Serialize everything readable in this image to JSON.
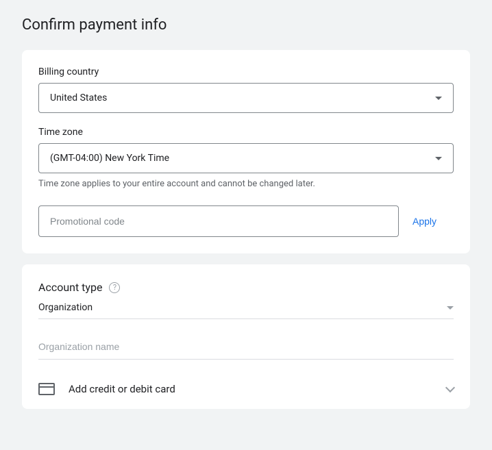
{
  "page_title": "Confirm payment info",
  "billing": {
    "country_label": "Billing country",
    "country_value": "United States",
    "timezone_label": "Time zone",
    "timezone_value": "(GMT-04:00) New York Time",
    "timezone_helper": "Time zone applies to your entire account and cannot be changed later.",
    "promo_placeholder": "Promotional code",
    "apply_label": "Apply"
  },
  "account": {
    "type_label": "Account type",
    "type_value": "Organization",
    "org_name_placeholder": "Organization name",
    "add_card_label": "Add credit or debit card"
  }
}
